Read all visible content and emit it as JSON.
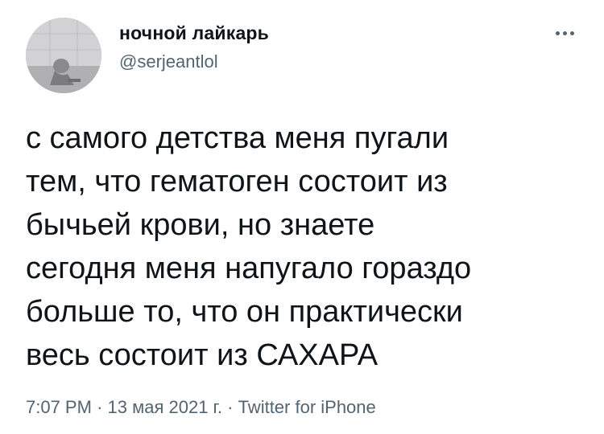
{
  "author": {
    "display_name": "ночной лайкарь",
    "handle": "@serjeantlol",
    "avatar_icon": "profile-photo"
  },
  "more_icon": "more-horizontal-icon",
  "tweet": {
    "lines": [
      "с самого детства меня пугали",
      "тем, что гематоген состоит из",
      "бычьей крови, но знаете",
      "сегодня меня напугало гораздо",
      "больше то, что он практически",
      "весь состоит из САХАРА"
    ]
  },
  "meta": {
    "time": "7:07 PM",
    "separator": "·",
    "date": "13 мая 2021 г.",
    "source": "Twitter for iPhone"
  },
  "colors": {
    "text": "#0f1419",
    "secondary": "#536471",
    "background": "#ffffff"
  }
}
